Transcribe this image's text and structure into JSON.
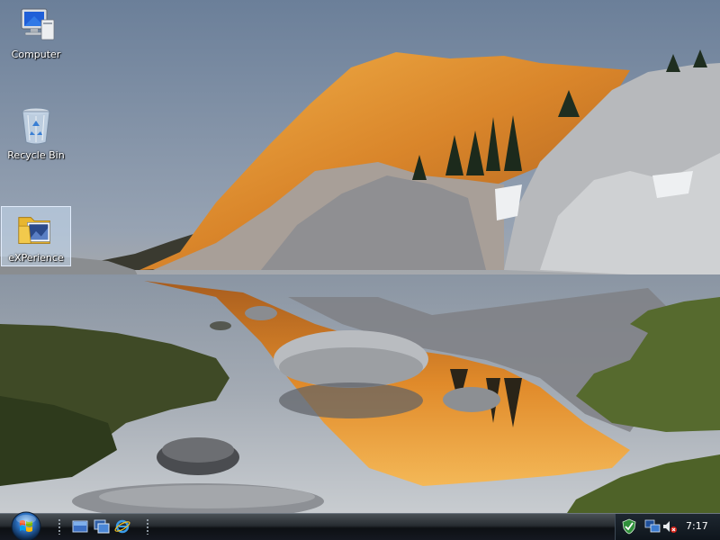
{
  "desktop": {
    "wallpaper": "mountain-lake-reflection",
    "icons": [
      {
        "label": "Computer",
        "icon": "computer-icon"
      },
      {
        "label": "Recycle Bin",
        "icon": "recycle-bin-icon"
      },
      {
        "label": "eXPerience",
        "icon": "folder-icon",
        "selected": true
      }
    ]
  },
  "taskbar": {
    "start_button": {
      "icon": "windows-start-orb-icon"
    },
    "quick_launch": [
      {
        "icon": "show-desktop-icon"
      },
      {
        "icon": "switch-windows-icon"
      },
      {
        "icon": "internet-explorer-icon"
      }
    ],
    "tray": {
      "icons": [
        "windows-defender-icon",
        "network-icon",
        "volume-muted-icon"
      ],
      "clock": "7:17"
    }
  },
  "colors": {
    "taskbar_dark": "#0d1014",
    "sky": "#8a9db5",
    "sunlit_rock": "#e0962c",
    "label_text": "#ffffff"
  }
}
